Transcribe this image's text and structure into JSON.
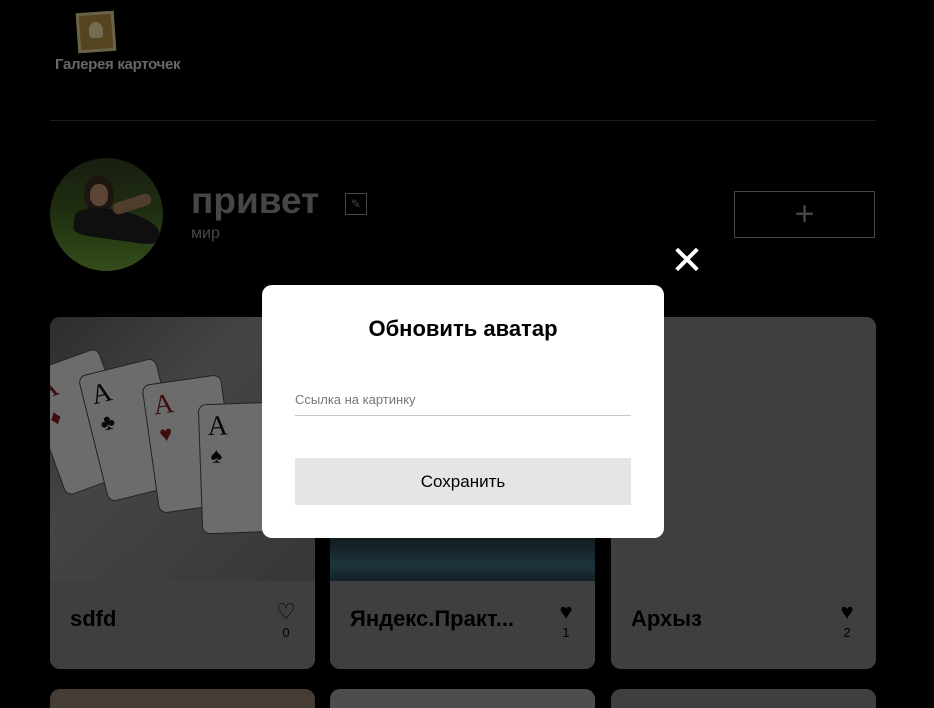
{
  "header": {
    "logo_text": "Галерея карточек"
  },
  "profile": {
    "name": "привет",
    "about": "мир",
    "add_button_label": "+",
    "edit_icon_glyph": "✎"
  },
  "cards": [
    {
      "title": "sdfd",
      "likes": "0",
      "liked": false,
      "like_icon": "heart-outline-icon"
    },
    {
      "title": "Яндекс.Практ...",
      "likes": "1",
      "liked": true,
      "like_icon": "heart-filled-icon"
    },
    {
      "title": "Архыз",
      "likes": "2",
      "liked": true,
      "like_icon": "heart-filled-icon"
    }
  ],
  "playing_cards": [
    {
      "letter": "A",
      "suit": "♦",
      "color": "red"
    },
    {
      "letter": "A",
      "suit": "♣",
      "color": "black"
    },
    {
      "letter": "A",
      "suit": "♥",
      "color": "red"
    },
    {
      "letter": "A",
      "suit": "♠",
      "color": "black"
    }
  ],
  "modal": {
    "title": "Обновить аватар",
    "input_placeholder": "Ссылка на картинку",
    "input_value": "",
    "save_label": "Сохранить",
    "close_glyph": "✕"
  },
  "colors": {
    "background": "#000000",
    "card": "#7f7f7f",
    "modal": "#ffffff",
    "save_button": "#e5e5e5",
    "muted_text": "#8d8d8d"
  }
}
